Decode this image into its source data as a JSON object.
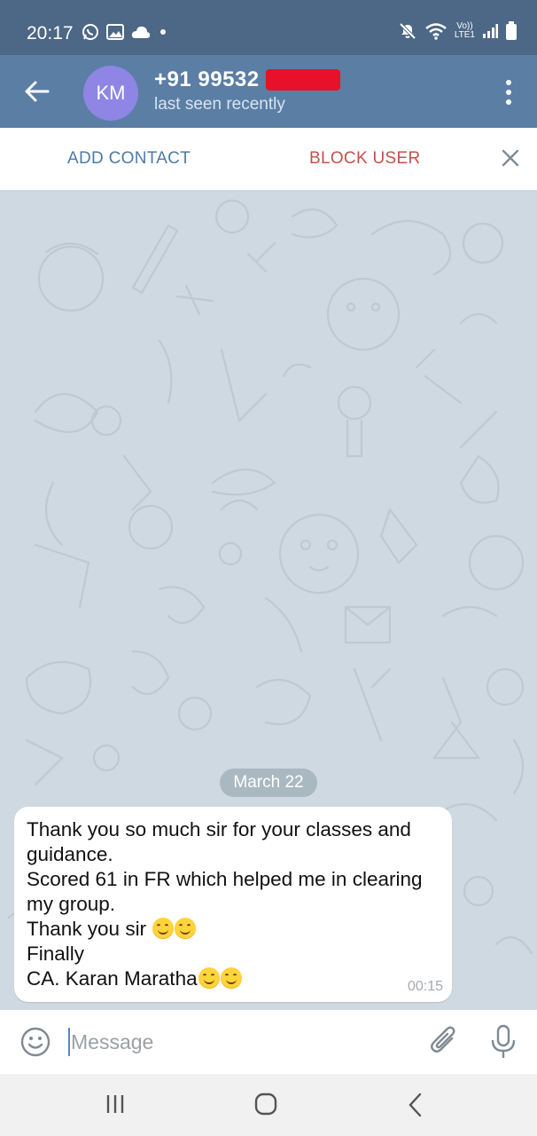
{
  "status_bar": {
    "time": "20:17",
    "left_icons": [
      "whatsapp-icon",
      "gallery-icon",
      "cloud-icon",
      "dot-icon"
    ],
    "right_icons": [
      "mute-icon",
      "wifi-icon",
      "volte-icon",
      "signal-icon",
      "battery-icon"
    ],
    "volte_label": "Vo))",
    "lte_label": "LTE1"
  },
  "header": {
    "avatar_initials": "KM",
    "contact_name": "+91 99532",
    "last_seen": "last seen recently",
    "avatar_color": "#8e85e4",
    "bar_color": "#5b7ea5"
  },
  "actions": {
    "add_contact": "ADD CONTACT",
    "block_user": "BLOCK USER"
  },
  "chat": {
    "date_label": "March 22",
    "messages": [
      {
        "lines": [
          "Thank you so much sir for your classes and",
          "guidance.",
          "Scored 61 in FR which helped me in clearing",
          "my group.",
          "Thank you sir",
          "Finally",
          "CA. Karan Maratha"
        ],
        "time": "00:15"
      }
    ]
  },
  "composer": {
    "placeholder": "Message"
  },
  "colors": {
    "status_bar": "#4d6786",
    "accent_blue": "#4f7aa8",
    "block_red": "#c2514c",
    "chat_bg": "#cfd9e1"
  }
}
